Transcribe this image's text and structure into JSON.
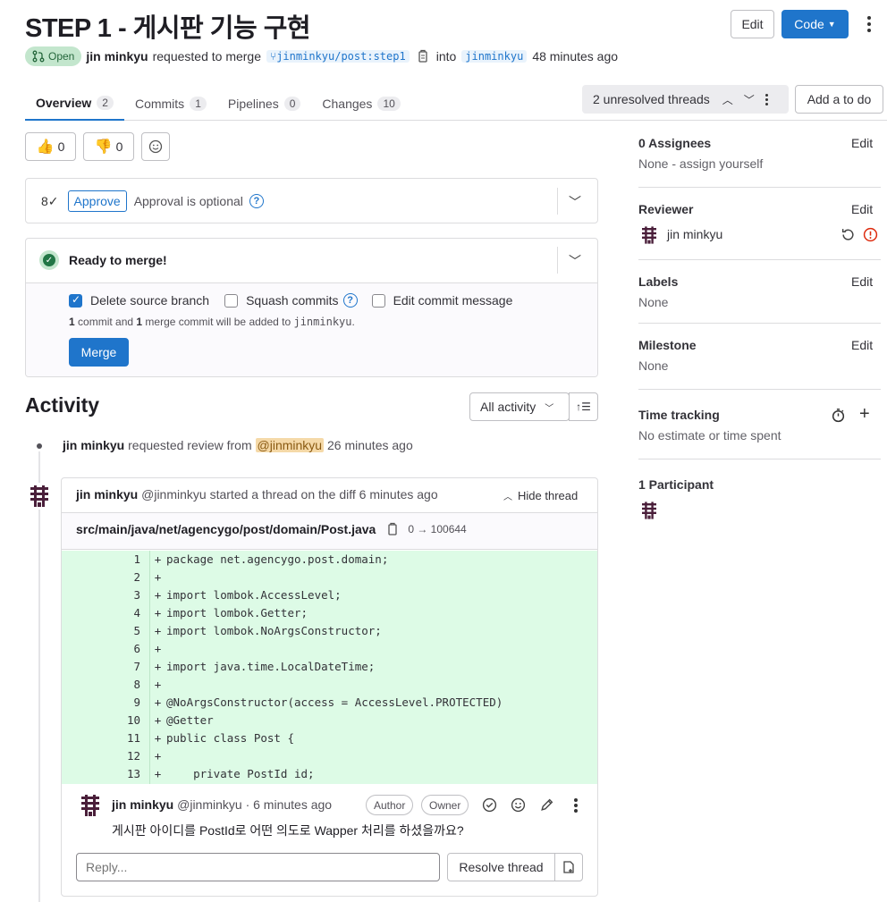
{
  "header": {
    "title": "STEP 1 - 게시판 기능 구현",
    "edit_label": "Edit",
    "code_label": "Code",
    "status": "Open",
    "author": "jin minkyu",
    "requested_text": "requested to merge",
    "source_branch": "jinminkyu/post:step1",
    "into_text": "into",
    "target_branch": "jinminkyu",
    "time": "48 minutes ago"
  },
  "tabs": [
    {
      "label": "Overview",
      "count": "2"
    },
    {
      "label": "Commits",
      "count": "1"
    },
    {
      "label": "Pipelines",
      "count": "0"
    },
    {
      "label": "Changes",
      "count": "10"
    }
  ],
  "threads": {
    "label": "2 unresolved threads",
    "todo_label": "Add a to do"
  },
  "reactions": {
    "thumbsup": "0",
    "thumbsdown": "0"
  },
  "approval": {
    "approve_label": "Approve",
    "optional_text": "Approval is optional"
  },
  "merge": {
    "ready_text": "Ready to merge!",
    "delete_source": "Delete source branch",
    "squash": "Squash commits",
    "edit_msg": "Edit commit message",
    "info_a": "1",
    "info_b": " commit and ",
    "info_c": "1",
    "info_d": " merge commit will be added to ",
    "info_branch": "jinminkyu",
    "info_end": ".",
    "merge_label": "Merge"
  },
  "activity": {
    "title": "Activity",
    "filter": "All activity",
    "event_user": "jin minkyu",
    "event_text": "requested review from",
    "event_mention": "@jinminkyu",
    "event_time": "26 minutes ago"
  },
  "thread": {
    "user": "jin minkyu",
    "handle": "@jinminkyu",
    "text": "started a thread on the diff",
    "time": "6 minutes ago",
    "hide_label": "Hide thread",
    "file_path": "src/main/java/net/agencygo/post/domain/Post.java",
    "file_mode": "0 → 100644"
  },
  "code_lines": [
    {
      "n": "1",
      "code": "package net.agencygo.post.domain;"
    },
    {
      "n": "2",
      "code": ""
    },
    {
      "n": "3",
      "code": "import lombok.AccessLevel;"
    },
    {
      "n": "4",
      "code": "import lombok.Getter;"
    },
    {
      "n": "5",
      "code": "import lombok.NoArgsConstructor;"
    },
    {
      "n": "6",
      "code": ""
    },
    {
      "n": "7",
      "code": "import java.time.LocalDateTime;"
    },
    {
      "n": "8",
      "code": ""
    },
    {
      "n": "9",
      "code": "@NoArgsConstructor(access = AccessLevel.PROTECTED)"
    },
    {
      "n": "10",
      "code": "@Getter"
    },
    {
      "n": "11",
      "code": "public class Post {"
    },
    {
      "n": "12",
      "code": ""
    },
    {
      "n": "13",
      "code": "    private PostId id;"
    }
  ],
  "comment": {
    "user": "jin minkyu",
    "meta": "@jinminkyu · 6 minutes ago",
    "author_badge": "Author",
    "owner_badge": "Owner",
    "body": "게시판 아이디를 PostId로 어떤 의도로 Wapper 처리를 하셨을까요?",
    "reply_placeholder": "Reply...",
    "resolve_label": "Resolve thread"
  },
  "sidebar": {
    "assignees_title": "0 Assignees",
    "assignees_value": "None - assign yourself",
    "reviewer_title": "Reviewer",
    "reviewer_name": "jin minkyu",
    "labels_title": "Labels",
    "labels_value": "None",
    "milestone_title": "Milestone",
    "milestone_value": "None",
    "time_title": "Time tracking",
    "time_value": "No estimate or time spent",
    "participants_title": "1 Participant",
    "edit_label": "Edit"
  },
  "colors": {
    "accent": "#1f75cb",
    "open_badge_bg": "#c3e6cd",
    "diff_added_bg": "#ddfbe6",
    "mention_bg": "#f5d9a8"
  }
}
